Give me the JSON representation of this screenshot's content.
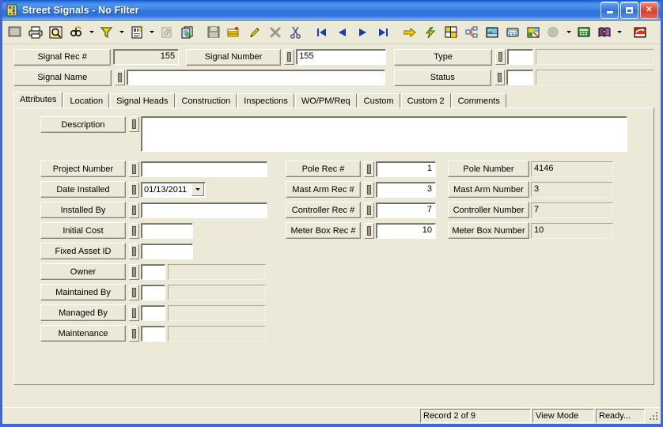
{
  "window": {
    "title": "Street Signals - No Filter",
    "app_icon": "traffic-signal-grid-icon",
    "minimize_label": "Minimize",
    "maximize_label": "Maximize",
    "close_label": "Close",
    "close_glyph": "✕"
  },
  "toolbar": {
    "groups": [
      [
        {
          "name": "screen-icon",
          "label": "Screen"
        },
        {
          "name": "print-icon",
          "label": "Print"
        },
        {
          "name": "print-preview-icon",
          "label": "Print Preview"
        },
        {
          "name": "find-icon",
          "label": "Find",
          "dropdown": true
        },
        {
          "name": "filter-icon",
          "label": "Filter",
          "dropdown": true
        },
        {
          "name": "report-icon",
          "label": "Report",
          "dropdown": true
        },
        {
          "name": "properties-icon",
          "label": "Properties"
        },
        {
          "name": "copy-record-icon",
          "label": "Copy Record"
        }
      ],
      [
        {
          "name": "save-icon",
          "label": "Save"
        },
        {
          "name": "add-record-icon",
          "label": "Add Record"
        },
        {
          "name": "edit-icon",
          "label": "Edit"
        },
        {
          "name": "delete-icon",
          "label": "Delete"
        },
        {
          "name": "cut-icon",
          "label": "Cut"
        }
      ],
      [
        {
          "name": "first-record-icon",
          "label": "First Record"
        },
        {
          "name": "previous-record-icon",
          "label": "Previous Record"
        },
        {
          "name": "next-record-icon",
          "label": "Next Record"
        },
        {
          "name": "last-record-icon",
          "label": "Last Record"
        }
      ],
      [
        {
          "name": "goto-icon",
          "label": "Go To"
        },
        {
          "name": "lightning-icon",
          "label": "Quick Action"
        },
        {
          "name": "map-icon",
          "label": "Map"
        },
        {
          "name": "tree-icon",
          "label": "Hierarchy"
        },
        {
          "name": "image-icon",
          "label": "Images"
        },
        {
          "name": "phone-icon",
          "label": "Contacts"
        },
        {
          "name": "gis-icon",
          "label": "GIS"
        },
        {
          "name": "spell-check-icon",
          "label": "Spell Check",
          "dropdown": true
        },
        {
          "name": "calculator-icon",
          "label": "Calculator"
        },
        {
          "name": "book-icon",
          "label": "Lookup",
          "dropdown": true
        }
      ],
      [
        {
          "name": "exit-icon",
          "label": "Exit"
        }
      ]
    ]
  },
  "header": {
    "signal_rec": {
      "label": "Signal Rec #",
      "value": "155"
    },
    "signal_number": {
      "label": "Signal Number",
      "value": "155"
    },
    "type": {
      "label": "Type",
      "code": "",
      "value": ""
    },
    "signal_name": {
      "label": "Signal Name",
      "value": ""
    },
    "status": {
      "label": "Status",
      "code": "",
      "value": ""
    }
  },
  "tabs": [
    {
      "label": "Attributes",
      "active": true
    },
    {
      "label": "Location",
      "active": false
    },
    {
      "label": "Signal Heads",
      "active": false
    },
    {
      "label": "Construction",
      "active": false
    },
    {
      "label": "Inspections",
      "active": false
    },
    {
      "label": "WO/PM/Req",
      "active": false
    },
    {
      "label": "Custom",
      "active": false
    },
    {
      "label": "Custom 2",
      "active": false
    },
    {
      "label": "Comments",
      "active": false
    }
  ],
  "attributes": {
    "description": {
      "label": "Description",
      "value": ""
    },
    "left_column": [
      {
        "name": "project-number",
        "label": "Project Number",
        "value": "",
        "kind": "text"
      },
      {
        "name": "date-installed",
        "label": "Date Installed",
        "value": "01/13/2011",
        "kind": "date"
      },
      {
        "name": "installed-by",
        "label": "Installed By",
        "value": "",
        "kind": "text"
      },
      {
        "name": "initial-cost",
        "label": "Initial Cost",
        "value": "",
        "kind": "short"
      },
      {
        "name": "fixed-asset-id",
        "label": "Fixed Asset ID",
        "value": "",
        "kind": "short"
      },
      {
        "name": "owner",
        "label": "Owner",
        "code": "",
        "value": "",
        "kind": "coded"
      },
      {
        "name": "maintained-by",
        "label": "Maintained By",
        "code": "",
        "value": "",
        "kind": "coded"
      },
      {
        "name": "managed-by",
        "label": "Managed By",
        "code": "",
        "value": "",
        "kind": "coded"
      },
      {
        "name": "maintenance",
        "label": "Maintenance",
        "code": "",
        "value": "",
        "kind": "coded"
      }
    ],
    "mid_column": [
      {
        "name": "pole-rec",
        "label": "Pole Rec #",
        "value": "1"
      },
      {
        "name": "mast-arm-rec",
        "label": "Mast Arm Rec #",
        "value": "3"
      },
      {
        "name": "controller-rec",
        "label": "Controller Rec #",
        "value": "7"
      },
      {
        "name": "meter-box-rec",
        "label": "Meter Box Rec #",
        "value": "10"
      }
    ],
    "right_column": [
      {
        "name": "pole-number",
        "label": "Pole Number",
        "value": "4146"
      },
      {
        "name": "mast-arm-number",
        "label": "Mast Arm Number",
        "value": "3"
      },
      {
        "name": "controller-number",
        "label": "Controller Number",
        "value": "7"
      },
      {
        "name": "meter-box-number",
        "label": "Meter Box Number",
        "value": "10"
      }
    ]
  },
  "statusbar": {
    "record": "Record 2 of 9",
    "mode": "View Mode",
    "state": "Ready..."
  },
  "colors": {
    "titlebar_blue": "#2f75e2",
    "window_border": "#3f67cd",
    "face": "#ece9d8",
    "field_white": "#ffffff",
    "shadow": "#85827a"
  }
}
